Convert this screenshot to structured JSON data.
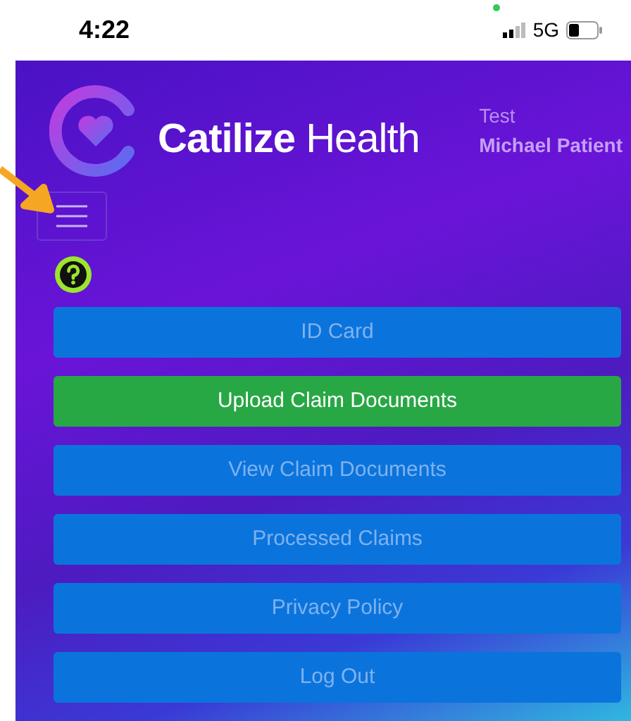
{
  "status_bar": {
    "time": "4:22",
    "network": "5G"
  },
  "header": {
    "brand": "**Catilize** Health",
    "user_group": "Test",
    "user_name": "Michael Patient"
  },
  "menu_items": [
    {
      "label": "ID Card",
      "selected": false
    },
    {
      "label": "Upload Claim Documents",
      "selected": true
    },
    {
      "label": "View Claim Documents",
      "selected": false
    },
    {
      "label": "Processed Claims",
      "selected": false
    },
    {
      "label": "Privacy Policy",
      "selected": false
    },
    {
      "label": "Log Out",
      "selected": false
    }
  ]
}
